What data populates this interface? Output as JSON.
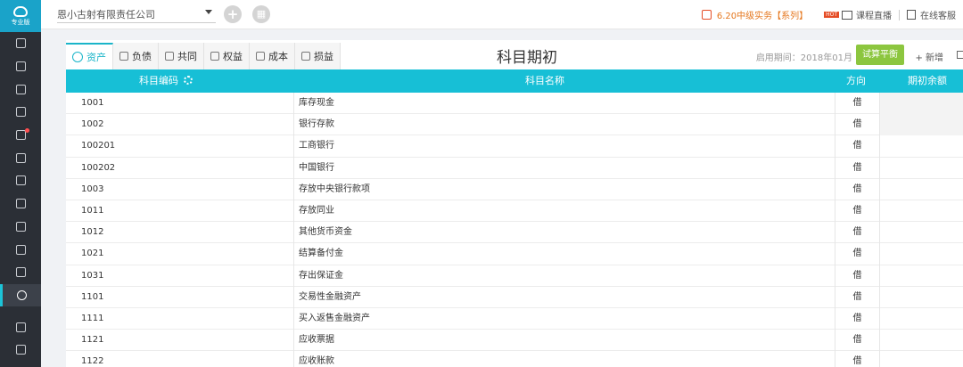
{
  "sidebar": {
    "logo_text": "专业版",
    "items": [
      {
        "name": "voucher-icon"
      },
      {
        "name": "ledger-icon"
      },
      {
        "name": "report-chart-icon"
      },
      {
        "name": "accounts-icon"
      },
      {
        "name": "tax-icon",
        "badge": true
      },
      {
        "name": "invoice-icon"
      },
      {
        "name": "asset-icon"
      },
      {
        "name": "salary-icon"
      },
      {
        "name": "cash-icon"
      },
      {
        "name": "search-doc-icon"
      },
      {
        "name": "shield-icon"
      },
      {
        "name": "settings-icon",
        "active": true
      }
    ],
    "bottom_items": [
      {
        "name": "video-icon"
      },
      {
        "name": "speed-icon"
      }
    ]
  },
  "topbar": {
    "company": "恩小古射有限责任公司",
    "promo_text": "6.20中级实务【系列】",
    "hot_badge": "HOT",
    "live_label": "课程直播",
    "service_label": "在线客服",
    "promo_color": "#e5771e"
  },
  "tabs": [
    {
      "label": "资产",
      "icon": "asset-circle-icon",
      "active": true
    },
    {
      "label": "负债",
      "icon": "liability-icon"
    },
    {
      "label": "共同",
      "icon": "common-icon"
    },
    {
      "label": "权益",
      "icon": "equity-icon"
    },
    {
      "label": "成本",
      "icon": "cost-icon"
    },
    {
      "label": "损益",
      "icon": "profit-loss-icon"
    }
  ],
  "page": {
    "title": "科目期初",
    "period_label": "启用期间：2018年01月",
    "trial_balance_label": "试算平衡",
    "add_label": "+ 新增"
  },
  "table": {
    "headers": {
      "code": "科目编码",
      "name": "科目名称",
      "direction": "方向",
      "balance": "期初余额"
    },
    "header_color": "#17bfd6",
    "rows": [
      {
        "code": "1001",
        "name": "库存现金",
        "dir": "借",
        "balance": ""
      },
      {
        "code": "1002",
        "name": "银行存款",
        "dir": "借",
        "balance": ""
      },
      {
        "code": "100201",
        "name": "工商银行",
        "dir": "借",
        "balance": ""
      },
      {
        "code": "100202",
        "name": "中国银行",
        "dir": "借",
        "balance": ""
      },
      {
        "code": "1003",
        "name": "存放中央银行款项",
        "dir": "借",
        "balance": ""
      },
      {
        "code": "1011",
        "name": "存放同业",
        "dir": "借",
        "balance": ""
      },
      {
        "code": "1012",
        "name": "其他货币资金",
        "dir": "借",
        "balance": ""
      },
      {
        "code": "1021",
        "name": "结算备付金",
        "dir": "借",
        "balance": ""
      },
      {
        "code": "1031",
        "name": "存出保证金",
        "dir": "借",
        "balance": ""
      },
      {
        "code": "1101",
        "name": "交易性金融资产",
        "dir": "借",
        "balance": ""
      },
      {
        "code": "1111",
        "name": "买入返售金融资产",
        "dir": "借",
        "balance": ""
      },
      {
        "code": "1121",
        "name": "应收票据",
        "dir": "借",
        "balance": ""
      },
      {
        "code": "1122",
        "name": "应收账款",
        "dir": "借",
        "balance": ""
      }
    ]
  }
}
